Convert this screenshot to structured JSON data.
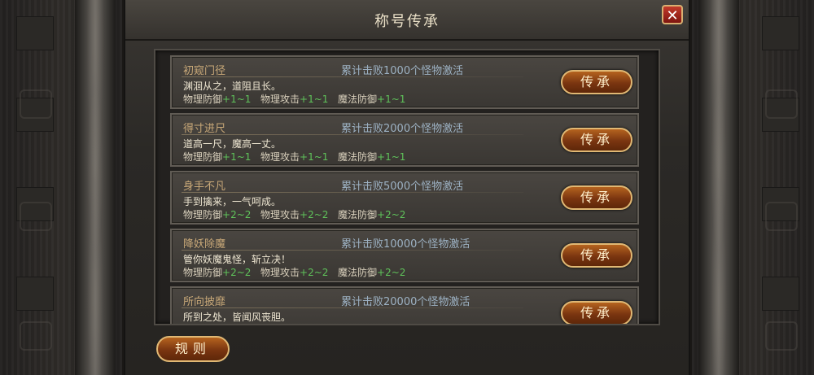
{
  "dialog": {
    "title": "称号传承",
    "close_label": "✕"
  },
  "rows": [
    {
      "name": "初窥门径",
      "condition": "累计击败1000个怪物激活",
      "desc": "渊洄从之，道阻且长。",
      "stats": [
        {
          "label": "物理防御",
          "value": "+1~1"
        },
        {
          "label": "物理攻击",
          "value": "+1~1"
        },
        {
          "label": "魔法防御",
          "value": "+1~1"
        }
      ],
      "button": "传承"
    },
    {
      "name": "得寸进尺",
      "condition": "累计击败2000个怪物激活",
      "desc": "道高一尺，魔高一丈。",
      "stats": [
        {
          "label": "物理防御",
          "value": "+1~1"
        },
        {
          "label": "物理攻击",
          "value": "+1~1"
        },
        {
          "label": "魔法防御",
          "value": "+1~1"
        }
      ],
      "button": "传承"
    },
    {
      "name": "身手不凡",
      "condition": "累计击败5000个怪物激活",
      "desc": "手到擒来，一气呵成。",
      "stats": [
        {
          "label": "物理防御",
          "value": "+2~2"
        },
        {
          "label": "物理攻击",
          "value": "+2~2"
        },
        {
          "label": "魔法防御",
          "value": "+2~2"
        }
      ],
      "button": "传承"
    },
    {
      "name": "降妖除魔",
      "condition": "累计击败10000个怪物激活",
      "desc": "管你妖魔鬼怪，斩立决！",
      "stats": [
        {
          "label": "物理防御",
          "value": "+2~2"
        },
        {
          "label": "物理攻击",
          "value": "+2~2"
        },
        {
          "label": "魔法防御",
          "value": "+2~2"
        }
      ],
      "button": "传承"
    },
    {
      "name": "所向披靡",
      "condition": "累计击败20000个怪物激活",
      "desc": "所到之处，皆闻风丧胆。",
      "stats": [],
      "button": "传承"
    }
  ],
  "rules_button": "规则",
  "colors": {
    "title_text": "#e9dfc6",
    "name_text": "#c8a878",
    "condition_text": "#9db2c4",
    "stat_value": "#5fc25a",
    "button_fill": "#7a3510",
    "button_border": "#e0b874",
    "close_fill": "#a3261c"
  }
}
